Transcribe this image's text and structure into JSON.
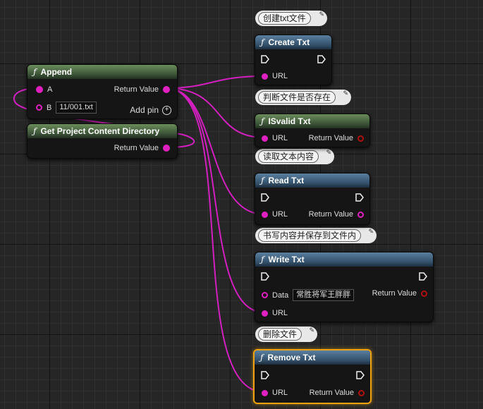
{
  "nodes": {
    "append": {
      "title": "Append",
      "pin_a": "A",
      "pin_b": "B",
      "pin_b_value": "11/001.txt",
      "return_label": "Return Value",
      "add_pin_label": "Add pin"
    },
    "project_dir": {
      "title": "Get Project Content Directory",
      "return_label": "Return Value"
    },
    "create": {
      "title": "Create Txt",
      "url_label": "URL"
    },
    "isvalid": {
      "title": "ISvalid Txt",
      "url_label": "URL",
      "return_label": "Return Value"
    },
    "read": {
      "title": "Read Txt",
      "url_label": "URL",
      "return_label": "Return Value"
    },
    "write": {
      "title": "Write Txt",
      "data_label": "Data",
      "data_value": "常胜将军王胖胖",
      "url_label": "URL",
      "return_label": "Return Value"
    },
    "remove": {
      "title": "Remove Txt",
      "url_label": "URL",
      "return_label": "Return Value"
    }
  },
  "comments": {
    "create": "创建txt文件",
    "isvalid": "判断文件是否存在",
    "read": "读取文本内容",
    "write": "书写内容并保存到文件内",
    "remove": "删除文件"
  },
  "colors": {
    "string_pin": "#e020c0",
    "bool_pin": "#b01010",
    "selection": "#f0a20f",
    "function_header": "#33506a",
    "pure_header": "#3a5136"
  },
  "icons": {
    "function": "f-italic",
    "exec": "exec-arrow",
    "add": "plus-circle",
    "comment_pin": "pushpin"
  }
}
